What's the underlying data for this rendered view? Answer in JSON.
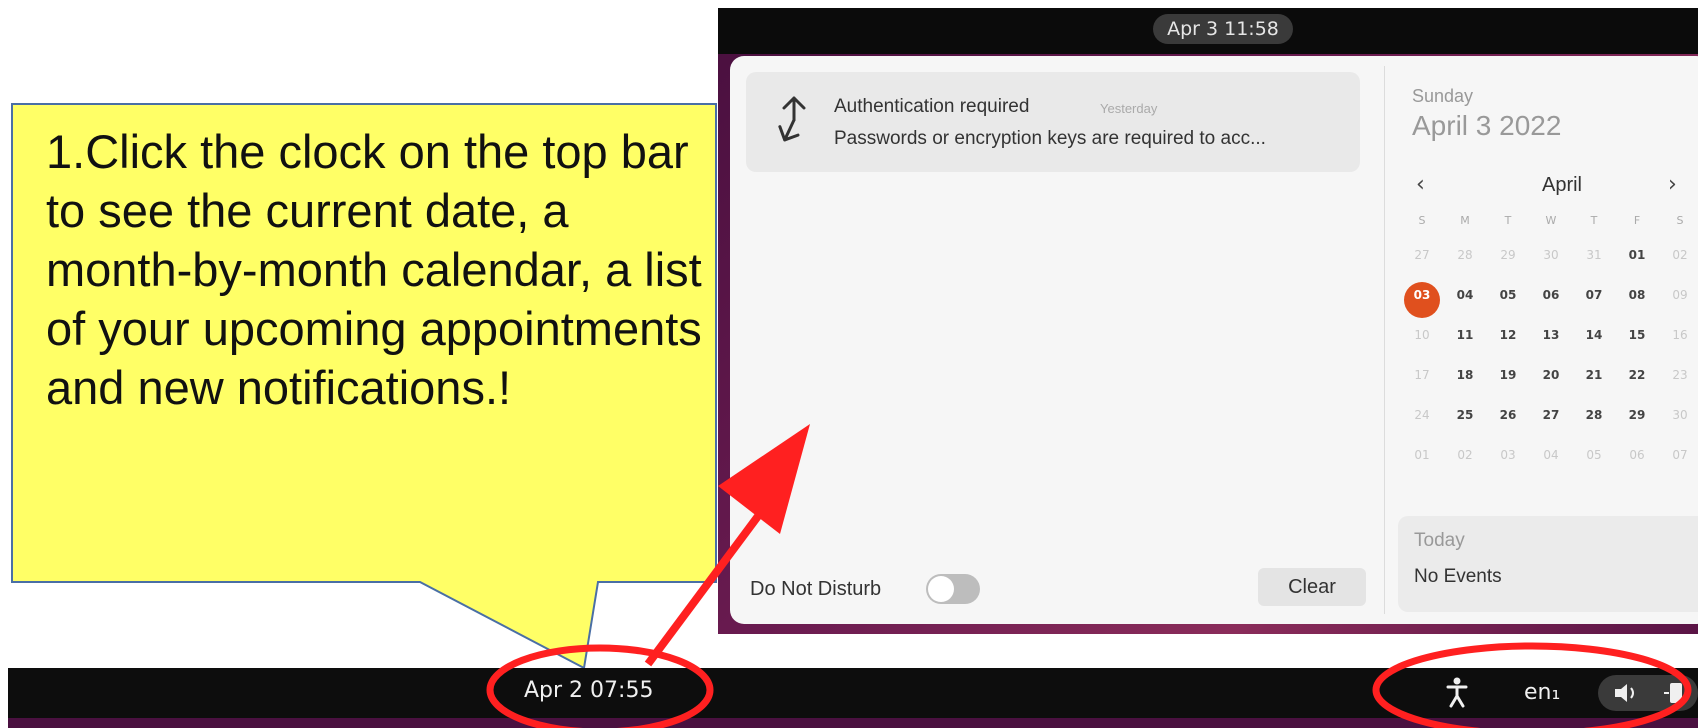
{
  "top_bar": {
    "clock": "Apr 3  11:58"
  },
  "notification": {
    "icon": "auth-refresh-icon",
    "title": "Authentication required",
    "time": "Yesterday",
    "body": "Passwords or encryption keys are required to acc..."
  },
  "footer": {
    "dnd_label": "Do Not Disturb",
    "dnd_on": false,
    "clear_label": "Clear"
  },
  "calendar": {
    "weekday": "Sunday",
    "full_date": "April 3 2022",
    "prev_symbol": "‹",
    "month": "April",
    "next_symbol": "›",
    "headers": [
      "S",
      "M",
      "T",
      "W",
      "T",
      "F",
      "S"
    ],
    "weeks": [
      [
        {
          "d": "27",
          "dim": true
        },
        {
          "d": "28",
          "dim": true
        },
        {
          "d": "29",
          "dim": true
        },
        {
          "d": "30",
          "dim": true
        },
        {
          "d": "31",
          "dim": true
        },
        {
          "d": "01",
          "dim": false
        },
        {
          "d": "02",
          "dim": true
        }
      ],
      [
        {
          "d": "03",
          "today": true
        },
        {
          "d": "04"
        },
        {
          "d": "05"
        },
        {
          "d": "06"
        },
        {
          "d": "07"
        },
        {
          "d": "08"
        },
        {
          "d": "09",
          "dim": true
        }
      ],
      [
        {
          "d": "10",
          "dim": true
        },
        {
          "d": "11"
        },
        {
          "d": "12"
        },
        {
          "d": "13"
        },
        {
          "d": "14"
        },
        {
          "d": "15"
        },
        {
          "d": "16",
          "dim": true
        }
      ],
      [
        {
          "d": "17",
          "dim": true
        },
        {
          "d": "18"
        },
        {
          "d": "19"
        },
        {
          "d": "20"
        },
        {
          "d": "21"
        },
        {
          "d": "22"
        },
        {
          "d": "23",
          "dim": true
        }
      ],
      [
        {
          "d": "24",
          "dim": true
        },
        {
          "d": "25"
        },
        {
          "d": "26"
        },
        {
          "d": "27"
        },
        {
          "d": "28"
        },
        {
          "d": "29"
        },
        {
          "d": "30",
          "dim": true
        }
      ],
      [
        {
          "d": "01",
          "dim": true
        },
        {
          "d": "02",
          "dim": true
        },
        {
          "d": "03",
          "dim": true
        },
        {
          "d": "04",
          "dim": true
        },
        {
          "d": "05",
          "dim": true
        },
        {
          "d": "06",
          "dim": true
        },
        {
          "d": "07",
          "dim": true
        }
      ]
    ],
    "today_label": "Today",
    "events_text": "No Events",
    "today_color": "#e0501e"
  },
  "callout": {
    "text": "1.Click the clock on the top bar to see the current date, a month-by-month calendar, a list of your upcoming appointments and new notifications.!",
    "fill": "#ffff66",
    "annotation_color": "#ff2020"
  },
  "bottom_bar": {
    "clock": "Apr 2  07:55",
    "accessibility_icon": "accessibility-icon",
    "language": "en₁",
    "volume_icon": "volume-icon",
    "power_icon": "power-icon"
  }
}
